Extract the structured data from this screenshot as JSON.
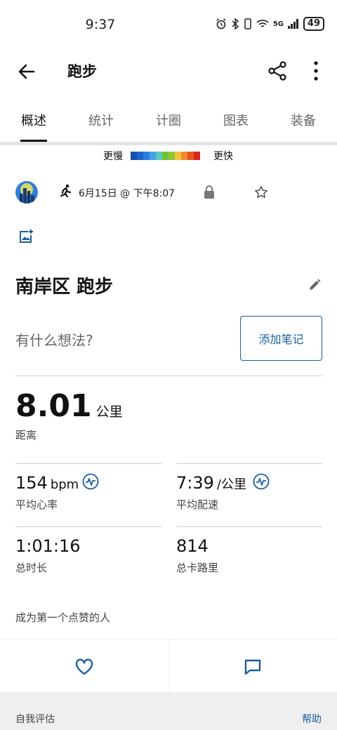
{
  "status_bar": {
    "time": "9:37",
    "network": "5G",
    "battery": "49"
  },
  "app_bar": {
    "title": "跑步"
  },
  "tabs": [
    {
      "label": "概述",
      "active": true
    },
    {
      "label": "统计",
      "active": false
    },
    {
      "label": "计圈",
      "active": false
    },
    {
      "label": "图表",
      "active": false
    },
    {
      "label": "装备",
      "active": false
    }
  ],
  "pace_legend": {
    "slow": "更慢",
    "fast": "更快",
    "colors": [
      "#1a4fb0",
      "#1f63c8",
      "#2b7fe0",
      "#45a2e8",
      "#5cc6c2",
      "#6fc238",
      "#93c63a",
      "#f2c23a",
      "#f08c2a",
      "#e8551e",
      "#d8271c"
    ]
  },
  "activity": {
    "date": "6月15日 @ 下午8:07",
    "title": "南岸区 跑步",
    "thoughts_placeholder": "有什么想法?",
    "add_note": "添加笔记"
  },
  "distance": {
    "value": "8.01",
    "unit": "公里",
    "label": "距离"
  },
  "stats": {
    "heart_rate": {
      "value": "154",
      "unit": "bpm",
      "label": "平均心率"
    },
    "pace": {
      "value": "7:39",
      "unit": "/公里",
      "label": "平均配速"
    },
    "duration": {
      "value": "1:01:16",
      "label": "总时长"
    },
    "calories": {
      "value": "814",
      "label": "总卡路里"
    }
  },
  "kudos": {
    "text": "成为第一个点赞的人"
  },
  "footer": {
    "self_assessment": "自我评估",
    "help": "帮助"
  },
  "colors": {
    "accent": "#1a5f9e"
  }
}
